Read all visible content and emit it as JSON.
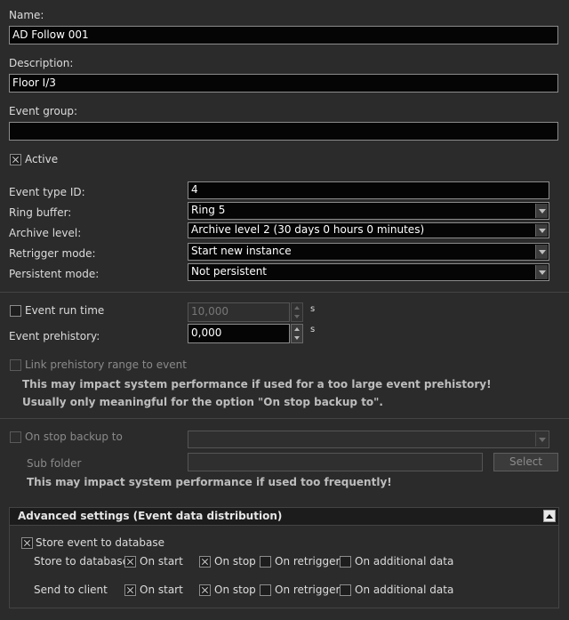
{
  "name": {
    "label": "Name:",
    "value": "AD Follow 001"
  },
  "description": {
    "label": "Description:",
    "value": "Floor I/3"
  },
  "event_group": {
    "label": "Event group:",
    "value": ""
  },
  "active": {
    "label": "Active",
    "checked": true
  },
  "event_type_id": {
    "label": "Event type ID:",
    "value": "4"
  },
  "ring_buffer": {
    "label": "Ring buffer:",
    "value": "Ring 5"
  },
  "archive_level": {
    "label": "Archive level:",
    "value": "Archive level 2 (30 days 0 hours 0 minutes)"
  },
  "retrigger_mode": {
    "label": "Retrigger mode:",
    "value": "Start new instance"
  },
  "persistent_mode": {
    "label": "Persistent mode:",
    "value": "Not persistent"
  },
  "event_run_time": {
    "label": "Event run time",
    "checked": false,
    "value": "10,000",
    "unit": "s"
  },
  "event_prehistory": {
    "label": "Event prehistory:",
    "value": "0,000",
    "unit": "s"
  },
  "link_prehistory": {
    "label": "Link prehistory range to event",
    "checked": false
  },
  "warnings": {
    "prehistory_1": "This may impact system performance if used for a too large event prehistory!",
    "prehistory_2": "Usually only meaningful for the option \"On stop backup to\".",
    "backup": "This may impact system performance if used too frequently!"
  },
  "on_stop_backup": {
    "label": "On stop backup to",
    "checked": false,
    "value": ""
  },
  "sub_folder": {
    "label": "Sub folder",
    "value": "",
    "button": "Select"
  },
  "advanced": {
    "title": "Advanced settings (Event data distribution)",
    "store_event": {
      "label": "Store event to database",
      "checked": true
    },
    "store_row": {
      "label": "Store to database",
      "options": [
        {
          "label": "On start",
          "checked": true
        },
        {
          "label": "On stop",
          "checked": true
        },
        {
          "label": "On retrigger",
          "checked": false
        },
        {
          "label": "On additional data",
          "checked": false
        }
      ]
    },
    "client_row": {
      "label": "Send to client",
      "options": [
        {
          "label": "On start",
          "checked": true
        },
        {
          "label": "On stop",
          "checked": true
        },
        {
          "label": "On retrigger",
          "checked": false
        },
        {
          "label": "On additional data",
          "checked": false
        }
      ]
    }
  }
}
